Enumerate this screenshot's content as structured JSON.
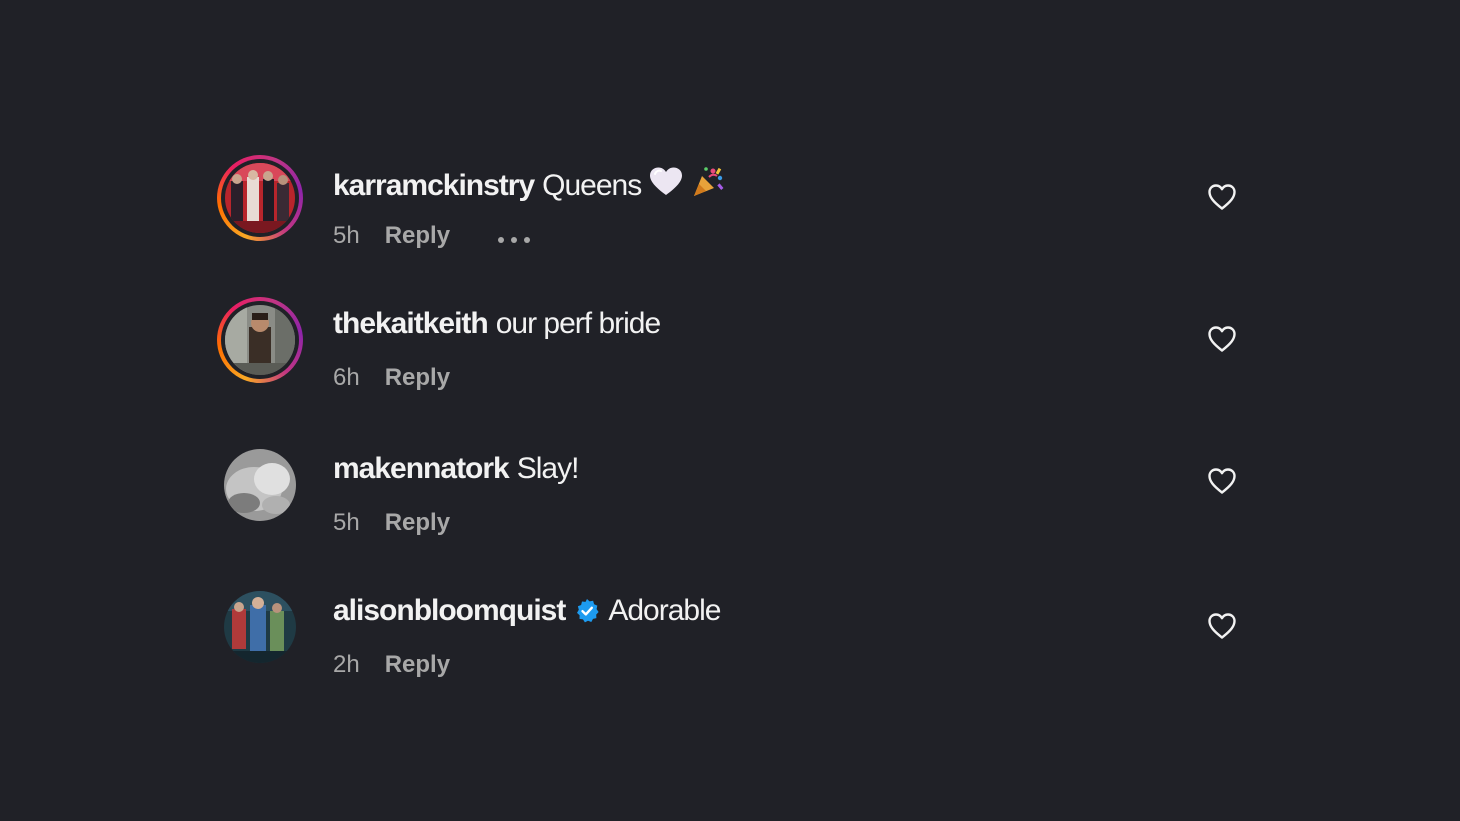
{
  "comments": [
    {
      "username": "karramckinstry",
      "text": "Queens",
      "emoji": [
        "white-heart",
        "party-popper"
      ],
      "time": "5h",
      "reply_label": "Reply",
      "has_more": true,
      "verified": false,
      "story_ring": true
    },
    {
      "username": "thekaitkeith",
      "text": "our perf bride",
      "emoji": [],
      "time": "6h",
      "reply_label": "Reply",
      "has_more": false,
      "verified": false,
      "story_ring": true
    },
    {
      "username": "makennatork",
      "text": "Slay!",
      "emoji": [],
      "time": "5h",
      "reply_label": "Reply",
      "has_more": false,
      "verified": false,
      "story_ring": false
    },
    {
      "username": "alisonbloomquist",
      "text": "Adorable",
      "emoji": [],
      "time": "2h",
      "reply_label": "Reply",
      "has_more": false,
      "verified": true,
      "story_ring": false
    }
  ],
  "icons": {
    "like": "heart-outline-icon",
    "more": "more-horizontal-icon",
    "verified": "verified-badge-icon"
  },
  "colors": {
    "background": "#202127",
    "primary_text": "#f2f2f2",
    "secondary_text": "#a8a8a8",
    "verified_blue": "#1d9bf0"
  }
}
